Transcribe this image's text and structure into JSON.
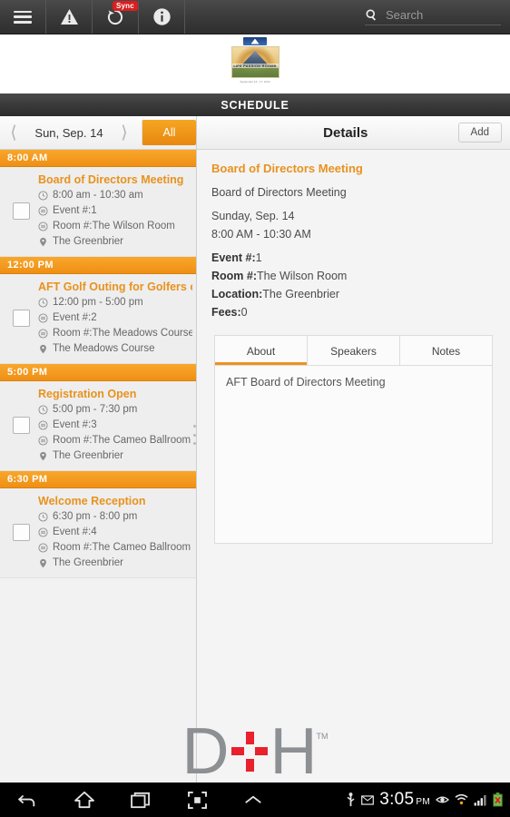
{
  "topbar": {
    "menu_icon": "hamburger-menu-icon",
    "alert_icon": "warning-triangle-icon",
    "sync_icon": "sync-refresh-icon",
    "sync_badge": "Sync",
    "info_icon": "info-circle-icon",
    "search_icon": "search-icon",
    "search_placeholder": "Search"
  },
  "logo": {
    "line1": "LIFE PASSION ROOMS",
    "line2": "AFT FALL SUMMIT",
    "caption": "September 14 - 17, 2014"
  },
  "schedule_bar": {
    "title": "SCHEDULE"
  },
  "date_nav": {
    "prev_icon": "chevron-left-icon",
    "date": "Sun, Sep. 14",
    "next_icon": "chevron-right-icon",
    "all_label": "All"
  },
  "schedule": {
    "groups": [
      {
        "time_header": "8:00 AM",
        "event": {
          "title": "Board of Directors Meeting",
          "time": "8:00 am - 10:30 am",
          "event_no": "Event #:1",
          "room": "Room #:The Wilson Room",
          "location": "The Greenbrier",
          "checked": false
        }
      },
      {
        "time_header": "12:00 PM",
        "event": {
          "title": "AFT Golf Outing for Golfers of Eve",
          "time": "12:00 pm - 5:00 pm",
          "event_no": "Event #:2",
          "room": "Room #:The Meadows Course",
          "location": "The Meadows Course",
          "checked": false
        }
      },
      {
        "time_header": "5:00 PM",
        "event": {
          "title": "Registration Open",
          "time": "5:00 pm - 7:30 pm",
          "event_no": "Event #:3",
          "room": "Room #:The Cameo Ballroom",
          "location": "The Greenbrier",
          "checked": false
        }
      },
      {
        "time_header": "6:30 PM",
        "event": {
          "title": "Welcome Reception",
          "time": "6:30 pm - 8:00 pm",
          "event_no": "Event #:4",
          "room": "Room #:The Cameo Ballroom",
          "location": "The Greenbrier",
          "checked": false
        }
      }
    ]
  },
  "details": {
    "header_title": "Details",
    "add_label": "Add",
    "title": "Board of Directors Meeting",
    "subtitle": "Board of Directors Meeting",
    "date": "Sunday, Sep. 14",
    "time": "8:00 AM - 10:30 AM",
    "event_label": "Event #:",
    "event_value": "1",
    "room_label": "Room #:",
    "room_value": "The Wilson Room",
    "location_label": "Location:",
    "location_value": "The Greenbrier",
    "fees_label": "Fees:",
    "fees_value": "0",
    "tabs": [
      {
        "label": "About",
        "active": true
      },
      {
        "label": "Speakers",
        "active": false
      },
      {
        "label": "Notes",
        "active": false
      }
    ],
    "about_text": "AFT Board of Directors Meeting"
  },
  "watermark": {
    "left_letter": "D",
    "right_letter": "H",
    "trademark": "TM",
    "plus_color": "#e8212c",
    "letter_color": "#8d9093"
  },
  "navbar": {
    "back_icon": "back-arrow-icon",
    "home_icon": "home-icon",
    "recents_icon": "recent-apps-icon",
    "screenshot_icon": "screenshot-capture-icon",
    "expand_icon": "chevron-up-icon",
    "usb_icon": "usb-icon",
    "mail_icon": "mail-icon",
    "time": "3:05",
    "meridiem": "PM",
    "eye_icon": "smart-stay-eye-icon",
    "wifi_icon": "wifi-icon",
    "signal_icon": "cell-signal-icon",
    "battery_icon": "battery-error-icon"
  },
  "colors": {
    "accent_orange": "#ef9220",
    "title_orange": "#e8921e",
    "dark_bar": "#3a3a3a"
  }
}
